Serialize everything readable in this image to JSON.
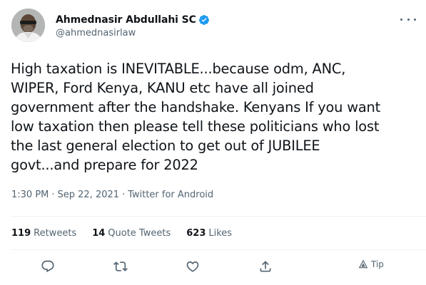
{
  "author": {
    "display_name": "Ahmednasir Abdullahi SC",
    "handle": "@ahmednasirlaw",
    "verified_icon": "verified-badge-icon"
  },
  "tweet": {
    "lines": [
      "High taxation is INEVITABLE...because odm, ANC,",
      "WIPER, Ford Kenya, KANU etc have all joined",
      "government after the handshake. Kenyans If you want",
      "low taxation then please tell these politicians who lost",
      "the last general election to get out of JUBILEE",
      "govt...and prepare for 2022"
    ]
  },
  "meta": {
    "time": "1:30 PM",
    "date": "Sep 22, 2021",
    "separator": "·",
    "source": "Twitter for Android"
  },
  "stats": {
    "retweets_count": "119",
    "retweets_label": "Retweets",
    "quotes_count": "14",
    "quotes_label": "Quote Tweets",
    "likes_count": "623",
    "likes_label": "Likes"
  },
  "actions": {
    "reply_icon": "reply-icon",
    "retweet_icon": "retweet-icon",
    "like_icon": "like-icon",
    "share_icon": "share-icon",
    "tip_label": "Tip"
  },
  "colors": {
    "text": "#0f1419",
    "secondary": "#536471",
    "verified": "#1d9bf0",
    "divider": "#eff3f4"
  }
}
